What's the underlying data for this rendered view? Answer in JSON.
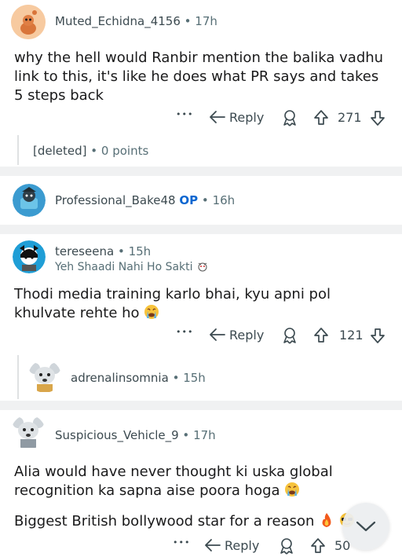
{
  "comments": [
    {
      "username": "Muted_Echidna_4156",
      "time": "17h",
      "body": "why the hell would Ranbir mention the balika vadhu link to this, it's like he does what PR says and takes 5 steps back",
      "reply_label": "Reply",
      "score": "271"
    },
    {
      "deleted_label": "[deleted]",
      "points": "0 points"
    },
    {
      "username": "Professional_Bake48",
      "op_badge": "OP",
      "time": "16h"
    },
    {
      "username": "tereseena",
      "time": "15h",
      "flair": "Yeh Shaadi Nahi Ho Sakti",
      "body": "Thodi media training karlo bhai, kyu apni pol khulvate rehte ho",
      "reply_label": "Reply",
      "score": "121"
    },
    {
      "username": "adrenalinsomnia",
      "time": "15h"
    },
    {
      "username": "Suspicious_Vehicle_9",
      "time": "17h",
      "body_line1": "Alia would have never thought ki uska global recognition ka sapna aise poora hoga",
      "body_line2": "Biggest British bollywood star for a reason",
      "reply_label": "Reply",
      "score": "50"
    }
  ],
  "separator": "•",
  "more": "•••",
  "colors": {
    "muted": "#576f76",
    "op_blue": "#0a66d0",
    "divider": "#f0f1f2"
  },
  "icons": [
    "reply-arrow-icon",
    "award-icon",
    "upvote-icon",
    "downvote-icon",
    "more-icon",
    "chevron-down-icon",
    "crying-emoji-icon",
    "fire-emoji-icon",
    "sunglasses-emoji-icon"
  ]
}
